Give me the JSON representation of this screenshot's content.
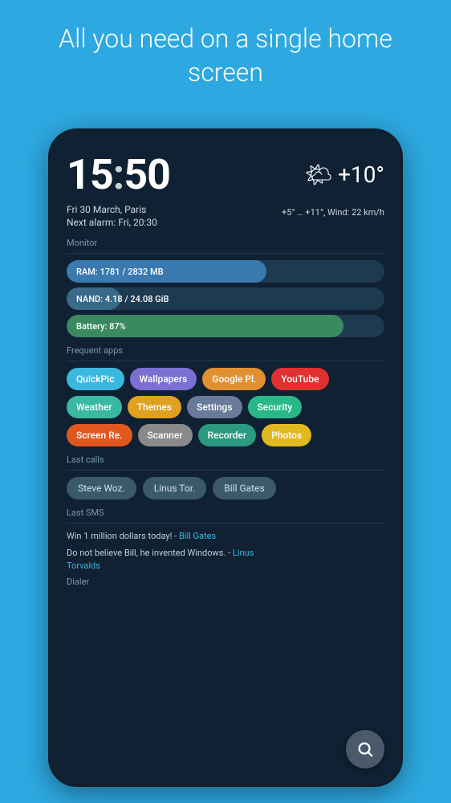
{
  "header": {
    "title": "All you need on a single home screen"
  },
  "phone": {
    "clock": {
      "hours": "15",
      "colon": ":",
      "minutes": "50"
    },
    "weather": {
      "icon": "🌤",
      "temperature": "+10°",
      "detail": "+5° … +11°, Wind: 22 km/h"
    },
    "date": "Fri 30 March, Paris",
    "alarm": "Next alarm: Fri, 20:30",
    "monitor": {
      "label": "Monitor",
      "ram": "RAM: 1781 / 2832 MB",
      "nand": "NAND: 4.18 / 24.08 GiB",
      "battery": "Battery: 87%"
    },
    "frequent_apps": {
      "label": "Frequent apps",
      "apps": [
        {
          "name": "QuickPic",
          "style": "quickpic"
        },
        {
          "name": "Wallpapers",
          "style": "wallpapers"
        },
        {
          "name": "Google Pl.",
          "style": "googlepl"
        },
        {
          "name": "YouTube",
          "style": "youtube"
        },
        {
          "name": "Weather",
          "style": "weather"
        },
        {
          "name": "Themes",
          "style": "themes"
        },
        {
          "name": "Settings",
          "style": "settings"
        },
        {
          "name": "Security",
          "style": "security"
        },
        {
          "name": "Screen Re.",
          "style": "screenre"
        },
        {
          "name": "Scanner",
          "style": "scanner"
        },
        {
          "name": "Recorder",
          "style": "recorder"
        },
        {
          "name": "Photos",
          "style": "photos"
        }
      ]
    },
    "last_calls": {
      "label": "Last calls",
      "contacts": [
        {
          "name": "Steve Woz."
        },
        {
          "name": "Linus Tor."
        },
        {
          "name": "Bill Gates"
        }
      ]
    },
    "last_sms": {
      "label": "Last SMS",
      "messages": [
        {
          "text": "Win 1 million dollars today!",
          "sender": "Bill Gates"
        },
        {
          "text": "Do not believe Bill, he invented Windows.",
          "sender": "Linus Torvalds"
        }
      ]
    },
    "dialer": {
      "label": "Dialer"
    }
  }
}
